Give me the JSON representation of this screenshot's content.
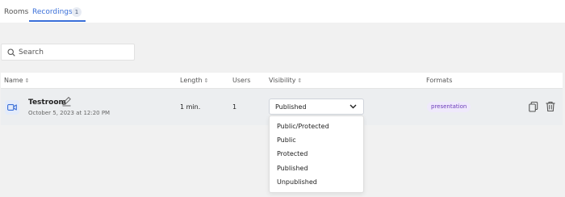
{
  "tabs": [
    {
      "label": "Rooms"
    },
    {
      "label": "Recordings",
      "badge": "1"
    }
  ],
  "search": {
    "placeholder": "Search"
  },
  "table": {
    "headers": {
      "name": "Name",
      "length": "Length",
      "users": "Users",
      "visibility": "Visibility",
      "formats": "Formats"
    },
    "rows": [
      {
        "name": "Testroom",
        "date": "October 5, 2023 at 12:20 PM",
        "length": "1 min.",
        "users": "1",
        "visibility": "Published",
        "format": "presentation"
      }
    ]
  },
  "visibility_options": [
    "Public/Protected",
    "Public",
    "Protected",
    "Published",
    "Unpublished"
  ],
  "colors": {
    "accent": "#3a6fd8",
    "format_badge": "#6a3ab8",
    "row_bg": "#eceef0"
  },
  "icons": [
    "search-icon",
    "video-icon",
    "edit-icon",
    "sort-icon",
    "chevron-down-icon",
    "copy-icon",
    "trash-icon"
  ]
}
